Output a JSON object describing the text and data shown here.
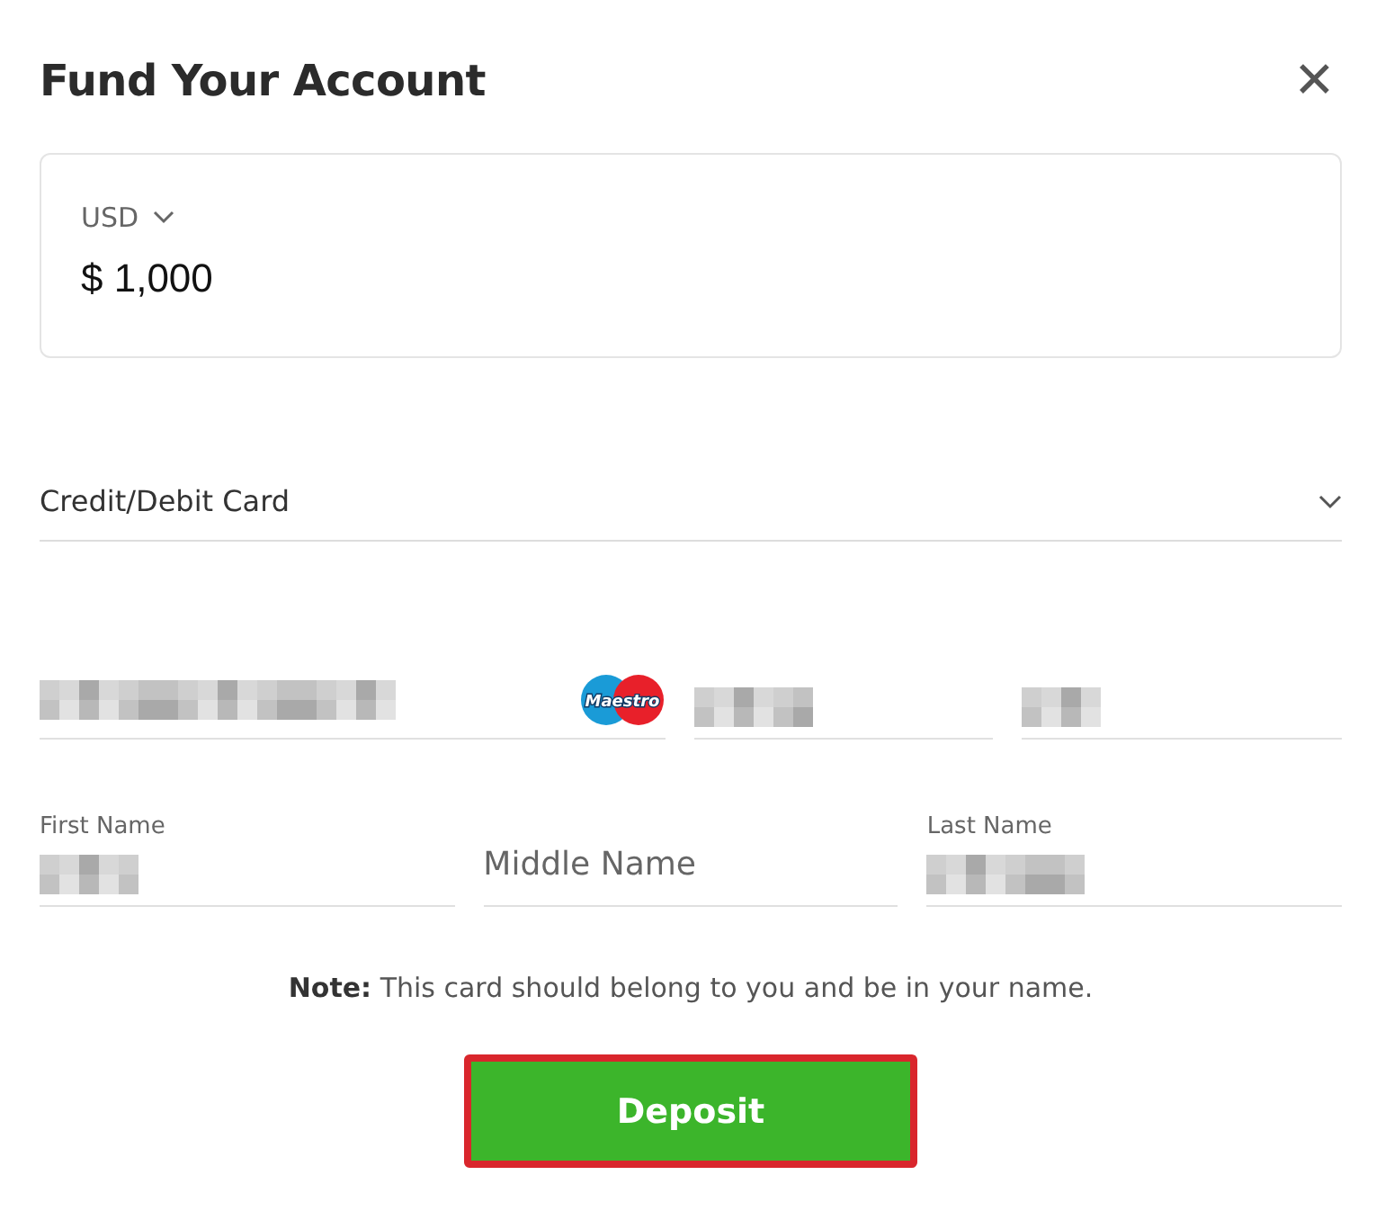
{
  "dialog": {
    "title": "Fund Your Account",
    "close": "✕"
  },
  "amount": {
    "currency": "USD",
    "value": "$ 1,000"
  },
  "payment_method": {
    "label": "Credit/Debit Card"
  },
  "card_fields": {
    "brand": "Maestro"
  },
  "name_fields": [
    {
      "label": "First Name"
    },
    {
      "placeholder": "Middle Name"
    },
    {
      "label": "Last Name"
    }
  ],
  "note": "**Note:** This card should belong to you and be in your name.",
  "deposit_button": {
    "label": "Deposit",
    "highlighted": true
  }
}
